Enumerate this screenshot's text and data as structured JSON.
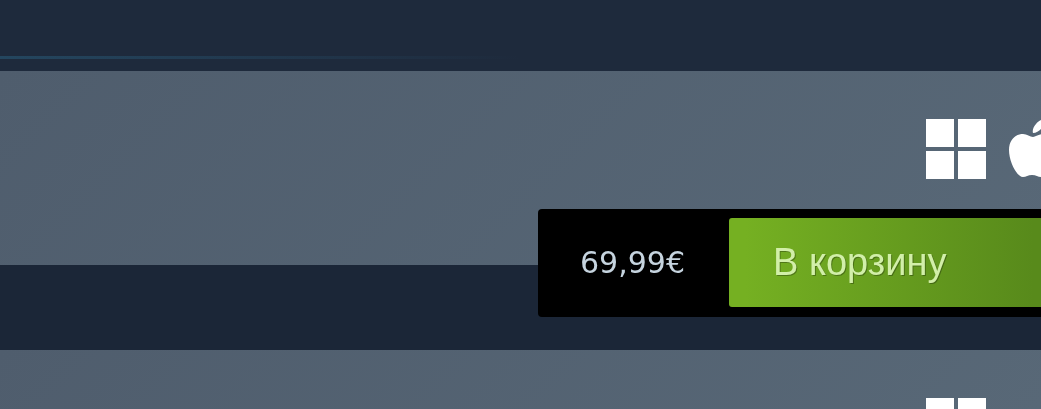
{
  "purchase": {
    "price": "69,99€",
    "button": "В корзину"
  }
}
